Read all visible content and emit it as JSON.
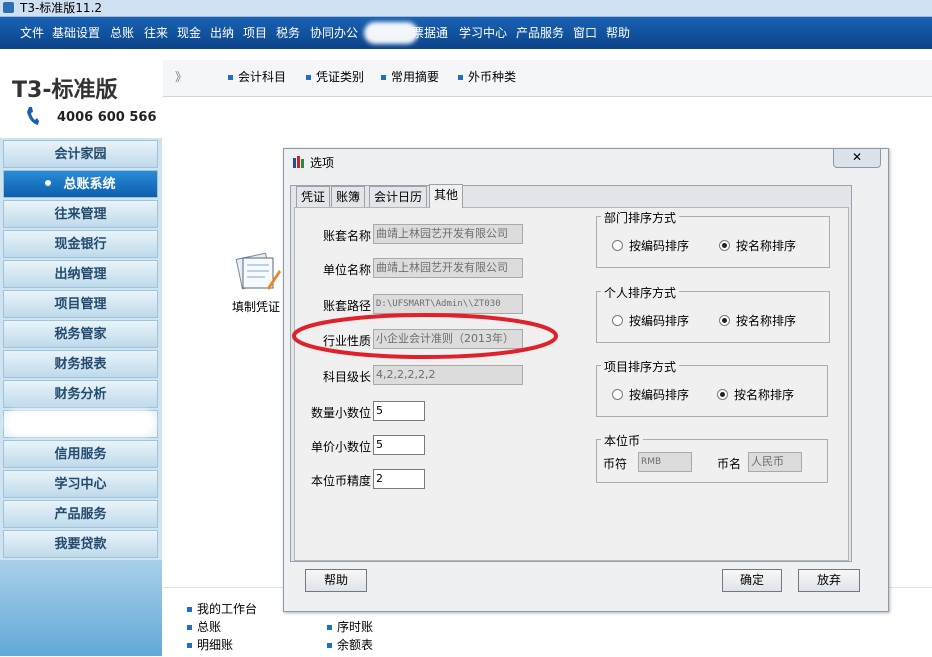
{
  "window": {
    "title": "T3-标准版11.2"
  },
  "menubar": {
    "items": [
      "文件",
      "基础设置",
      "总账",
      "往来",
      "现金",
      "出纳",
      "项目",
      "税务",
      "协同办公",
      "票据通",
      "学习中心",
      "产品服务",
      "窗口",
      "帮助"
    ]
  },
  "brand": {
    "logo": "T3-标准版",
    "phone": "4006 600 566"
  },
  "sidebar": {
    "items": [
      "会计家园",
      "总账系统",
      "往来管理",
      "现金银行",
      "出纳管理",
      "项目管理",
      "税务管家",
      "财务报表",
      "财务分析",
      "信用服务",
      "学习中心",
      "产品服务",
      "我要贷款"
    ]
  },
  "toolbar": {
    "items": [
      "会计科目",
      "凭证类别",
      "常用摘要",
      "外币种类"
    ],
    "chevron": "》"
  },
  "workspace": {
    "card_label": "填制凭证"
  },
  "bottom": {
    "col1": [
      "我的工作台",
      "总账",
      "明细账"
    ],
    "col2": [
      "序时账",
      "余额表"
    ]
  },
  "dialog": {
    "title": "选项",
    "close": "✕",
    "tabs": [
      "凭证",
      "账簿",
      "会计日历",
      "其他"
    ],
    "active_tab": "其他",
    "fields": {
      "account_set_name": {
        "label": "账套名称",
        "value": "曲靖上林园艺开发有限公司"
      },
      "unit_name": {
        "label": "单位名称",
        "value": "曲靖上林园艺开发有限公司"
      },
      "account_path": {
        "label": "账套路径",
        "value": "D:\\UFSMART\\Admin\\\\ZT030"
      },
      "industry": {
        "label": "行业性质",
        "value": "小企业会计准则（2013年）"
      },
      "subject_levels": {
        "label": "科目级长",
        "value": "4,2,2,2,2,2"
      },
      "qty_decimals": {
        "label": "数量小数位",
        "value": "5"
      },
      "price_decimals": {
        "label": "单价小数位",
        "value": "5"
      },
      "currency_precision": {
        "label": "本位币精度",
        "value": "2"
      }
    },
    "dept_sort": {
      "title": "部门排序方式",
      "options": [
        "按编码排序",
        "按名称排序"
      ],
      "selected": 1
    },
    "person_sort": {
      "title": "个人排序方式",
      "options": [
        "按编码排序",
        "按名称排序"
      ],
      "selected": 1
    },
    "project_sort": {
      "title": "项目排序方式",
      "options": [
        "按编码排序",
        "按名称排序"
      ],
      "selected": 1
    },
    "base_currency": {
      "title": "本位币",
      "symbol_label": "币符",
      "symbol_value": "RMB",
      "name_label": "币名",
      "name_value": "人民币"
    },
    "buttons": {
      "help": "帮助",
      "ok": "确定",
      "cancel": "放弃"
    }
  },
  "colors": {
    "menubar": "#0f4f99",
    "annotation": "#e0202a"
  }
}
